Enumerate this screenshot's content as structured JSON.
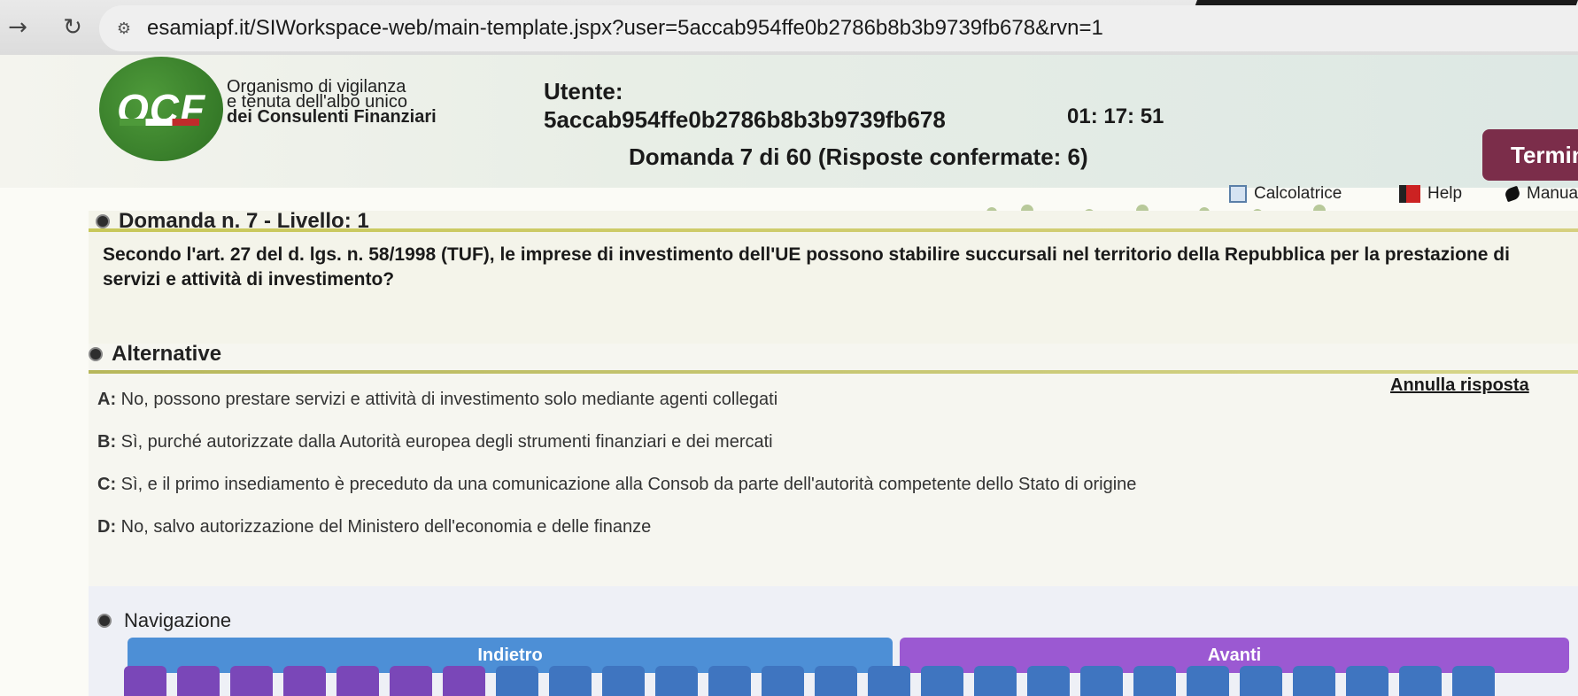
{
  "browser": {
    "url": "esamiapf.it/SIWorkspace-web/main-template.jspx?user=5accab954ffe0b2786b8b3b9739fb678&rvn=1"
  },
  "header": {
    "logo_text": "OCF",
    "org_line1": "Organismo di vigilanza",
    "org_line2": "e tenuta dell'albo unico",
    "org_line3": "dei Consulenti Finanziari",
    "user_label": "Utente:",
    "user_id": "5accab954ffe0b2786b8b3b9739fb678",
    "timer": "01: 17: 51",
    "termina_label": "Termina",
    "question_count": "Domanda 7 di 60 (Risposte confermate: 6)",
    "calc_label": "Calcolatrice",
    "help_label": "Help",
    "manual_label": "Manua"
  },
  "question": {
    "title": "Domanda n. 7 - Livello: 1",
    "text": "Secondo l'art. 27 del d. lgs. n. 58/1998 (TUF), le imprese di investimento dell'UE possono stabilire succursali nel territorio della Repubblica per la prestazione di servizi e attività di investimento?"
  },
  "alternatives": {
    "title": "Alternative",
    "annulla_label": "Annulla risposta",
    "items": [
      {
        "letter": "A:",
        "text": " No, possono prestare servizi e attività di investimento solo mediante agenti collegati"
      },
      {
        "letter": "B:",
        "text": " Sì, purché autorizzate dalla Autorità europea degli strumenti finanziari e dei mercati"
      },
      {
        "letter": "C:",
        "text": " Sì, e il primo insediamento è preceduto da una comunicazione alla Consob da parte dell'autorità competente dello Stato di origine"
      },
      {
        "letter": "D:",
        "text": " No, salvo autorizzazione del Ministero dell'economia e delle finanze"
      }
    ]
  },
  "navigation": {
    "title": "Navigazione",
    "back_label": "Indietro",
    "next_label": "Avanti"
  },
  "colors": {
    "termina": "#7b2d4a",
    "indietro": "#4d8fd6",
    "avanti": "#9b59d2",
    "logo_green": "#3e8a2e"
  }
}
